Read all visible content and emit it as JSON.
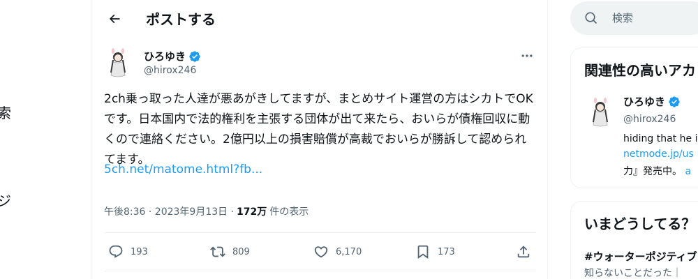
{
  "left_nav": {
    "fragment_1": "索",
    "fragment_2": "ジ"
  },
  "header": {
    "title": "ポストする",
    "back_icon": "arrow-left-icon"
  },
  "post": {
    "author_name": "ひろゆき",
    "author_handle": "@hirox246",
    "verified_color": "#1d9bf0",
    "text": "2ch乗っ取った人達が悪あがきしてますが、まとめサイト運営の方はシカトでOKです。日本国内で法的権利を主張する団体が出て来たら、おいらが債権回収に動くので連絡ください。2億円以上の損害賠償が高裁でおいらが勝訴して認められてます。",
    "link": "5ch.net/matome.html?fb...",
    "timestamp": "午後8:36 · 2023年9月13日 ·",
    "views_count": "172万",
    "views_label": "件の表示",
    "replies": "193",
    "reposts": "809",
    "likes": "6,170",
    "bookmarks": "173"
  },
  "search": {
    "placeholder": "検索"
  },
  "related": {
    "title": "関連性の高いアカ",
    "name": "ひろゆき",
    "handle": "@hirox246",
    "bio_line1": "hiding that he i",
    "bio_line2": "netmode.jp/us",
    "bio_line3_text": "力』発売中。",
    "bio_line3_link": "a"
  },
  "trends": {
    "title": "いまどうしてる？",
    "item_name": "#ウォーターポジティブ",
    "item_sub": "知らないことだった｜"
  },
  "colors": {
    "accent": "#1d9bf0",
    "text": "#0f1419",
    "muted": "#536471"
  }
}
